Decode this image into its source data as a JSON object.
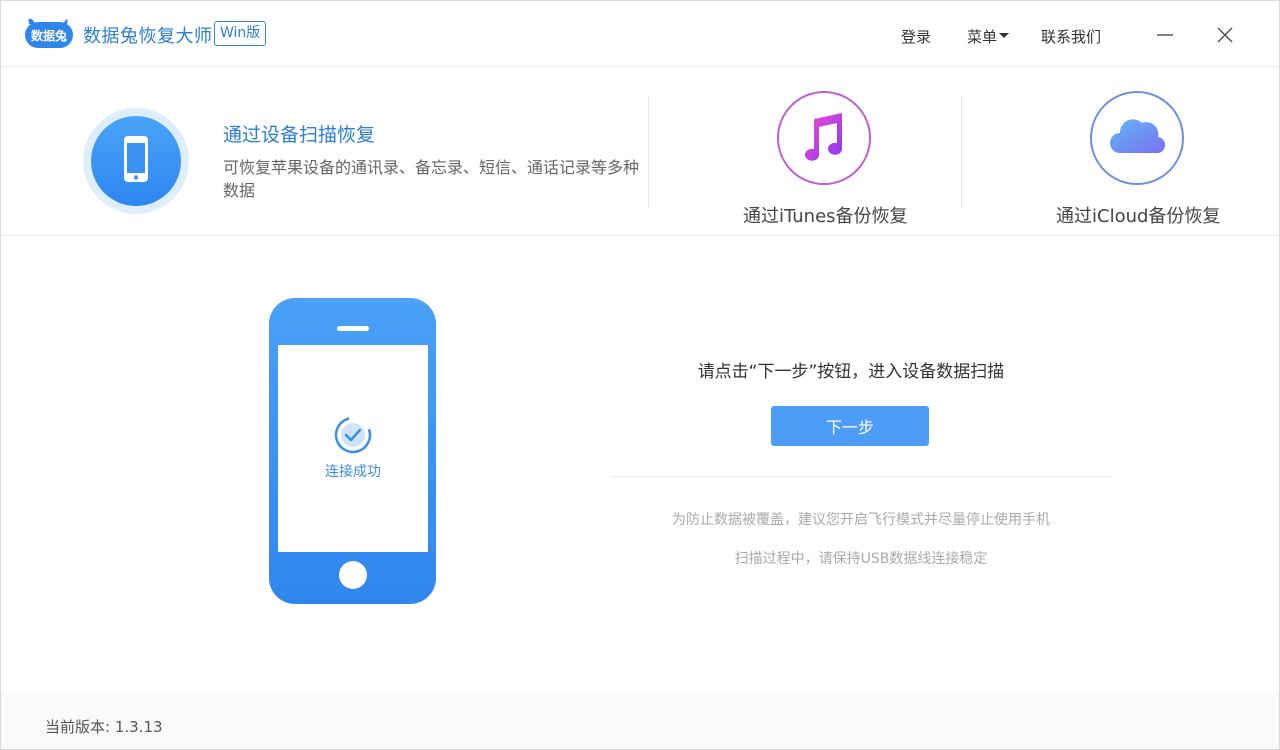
{
  "titlebar": {
    "logo_text": "数据兔",
    "app_title": "数据兔恢复大师",
    "badge": "Win版",
    "nav": {
      "login": "登录",
      "menu": "菜单",
      "contact": "联系我们"
    },
    "icons": {
      "minimize": "minimize-icon",
      "close": "close-icon"
    }
  },
  "modes": {
    "device_scan": {
      "title": "通过设备扫描恢复",
      "description": "可恢复苹果设备的通讯录、备忘录、短信、通话记录等多种数据",
      "icon": "phone-icon"
    },
    "itunes": {
      "label": "通过iTunes备份恢复",
      "icon": "music-note-icon"
    },
    "icloud": {
      "label": "通过iCloud备份恢复",
      "icon": "cloud-icon"
    }
  },
  "main": {
    "connection_status": "连接成功",
    "prompt": "请点击“下一步”按钮，进入设备数据扫描",
    "next_button": "下一步",
    "tip1": "为防止数据被覆盖，建议您开启飞行模式并尽量停止使用手机",
    "tip2": "扫描过程中，请保持USB数据线连接稳定"
  },
  "footer": {
    "version": "当前版本: 1.3.13"
  },
  "colors": {
    "brand_blue": "#2b7fd6",
    "button_blue": "#4d9df7",
    "itunes_gradient": [
      "#f24ad0",
      "#8a3af2"
    ],
    "icloud_gradient": [
      "#5fb8f8",
      "#7a6ff0"
    ]
  }
}
